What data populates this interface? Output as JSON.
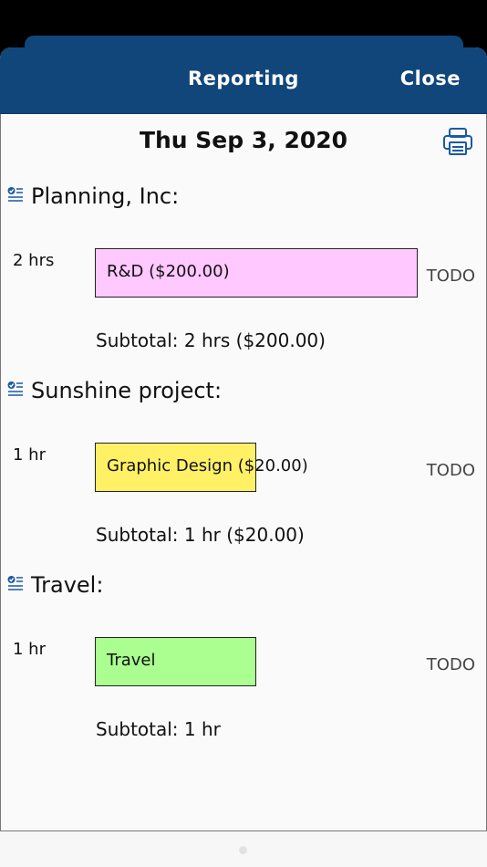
{
  "header": {
    "title": "Reporting",
    "close_label": "Close"
  },
  "report": {
    "date": "Thu Sep 3, 2020",
    "sections": [
      {
        "name": "Planning, Inc:",
        "hours": "2 hrs",
        "task": "R&D ($200.00)",
        "task_color": "#ffc8ff",
        "task_fraction": 1.0,
        "status": "TODO",
        "subtotal": "Subtotal: 2 hrs ($200.00)"
      },
      {
        "name": "Sunshine project:",
        "hours": "1 hr",
        "task": "Graphic Design ($20.00)",
        "task_color": "#fff066",
        "task_fraction": 0.5,
        "status": "TODO",
        "subtotal": "Subtotal: 1 hr ($20.00)"
      },
      {
        "name": "Travel:",
        "hours": "1 hr",
        "task": "Travel",
        "task_color": "#aaff90",
        "task_fraction": 0.5,
        "status": "TODO",
        "subtotal": "Subtotal: 1 hr"
      }
    ]
  },
  "icons": {
    "printer": "printer-icon",
    "section": "checklist-icon"
  },
  "colors": {
    "header_bg": "#10467a",
    "checklist_icon": "#1b5aa0"
  }
}
